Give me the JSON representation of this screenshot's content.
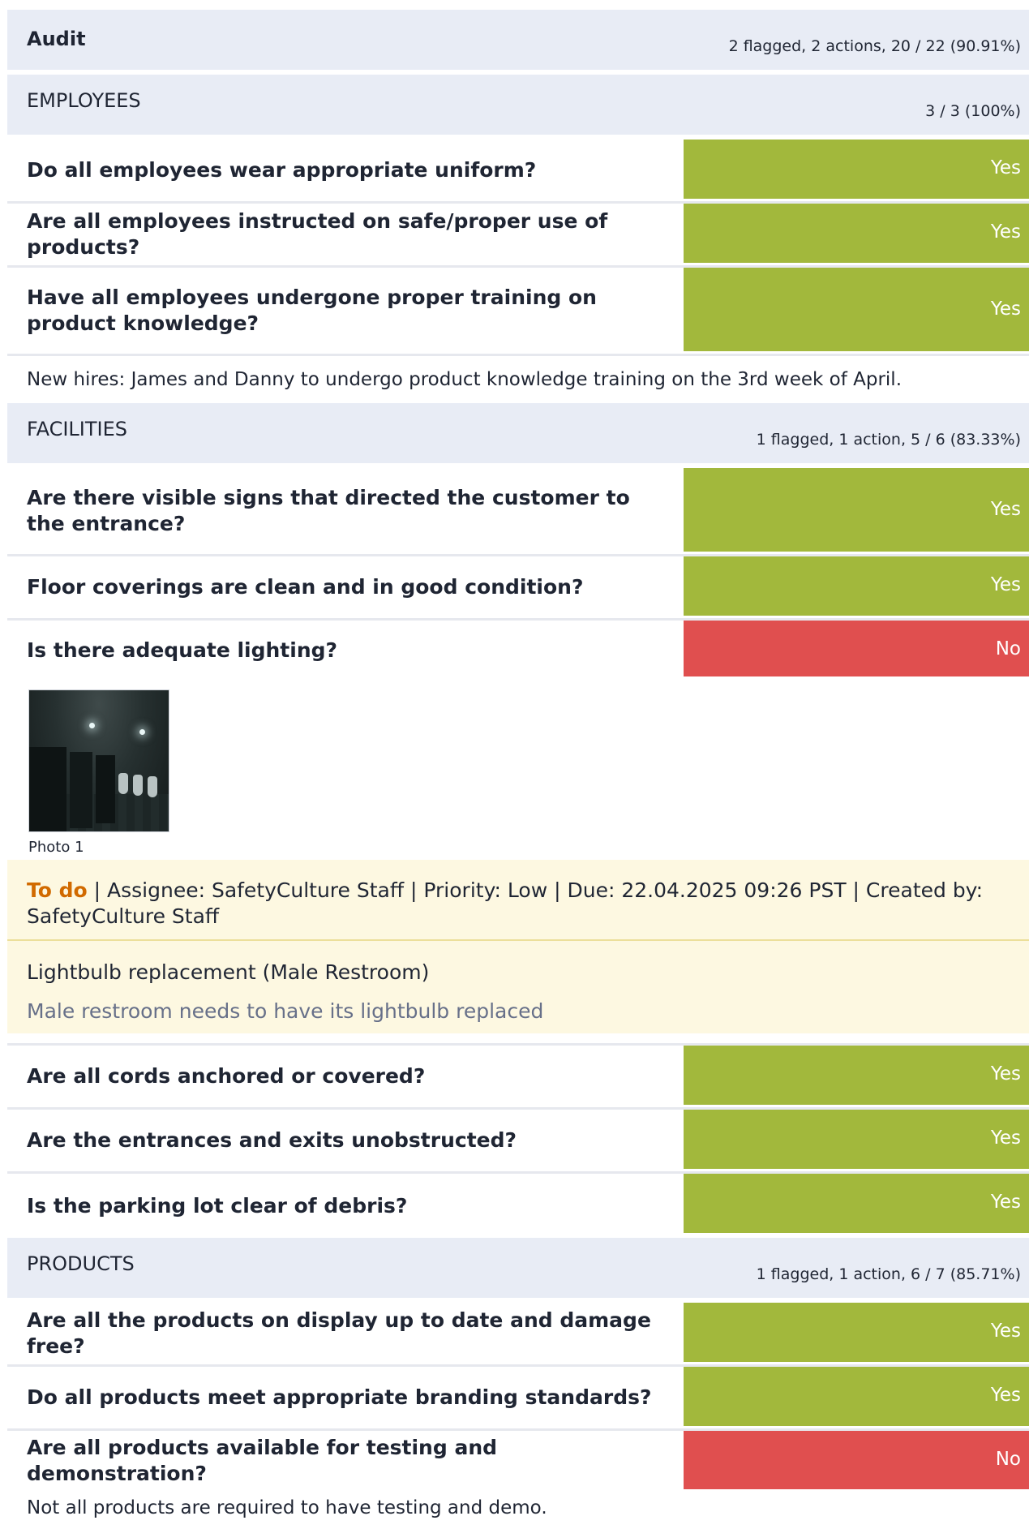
{
  "audit": {
    "title": "Audit",
    "stats": "2 flagged, 2 actions, 20 / 22 (90.91%)"
  },
  "sections": [
    {
      "title": "EMPLOYEES",
      "stats": "3 / 3 (100%)",
      "questions": [
        {
          "text": "Do all employees wear appropriate uniform?",
          "answer": "Yes"
        },
        {
          "text": "Are all employees instructed on safe/proper use of products?",
          "answer": "Yes"
        },
        {
          "text": "Have all employees undergone proper training on product knowledge?",
          "answer": "Yes"
        }
      ],
      "note": "New hires: James and Danny to undergo product knowledge training on the 3rd week of April."
    },
    {
      "title": "FACILITIES",
      "stats": "1 flagged, 1 action, 5 / 6 (83.33%)",
      "questions": [
        {
          "text": "Are there visible signs that directed the customer to the entrance?",
          "answer": "Yes"
        },
        {
          "text": "Floor coverings are clean and in good condition?",
          "answer": "Yes"
        },
        {
          "text": "Is there adequate lighting?",
          "answer": "No"
        },
        {
          "text": "Are all cords anchored or covered?",
          "answer": "Yes"
        },
        {
          "text": "Are the entrances and exits unobstructed?",
          "answer": "Yes"
        },
        {
          "text": "Is the parking lot clear of debris?",
          "answer": "Yes"
        }
      ],
      "photo_caption": "Photo 1",
      "action": {
        "status": "To do",
        "details": " |  Assignee: SafetyCulture Staff  |  Priority: Low  |  Due: 22.04.2025 09:26 PST  |  Created by: SafetyCulture Staff",
        "title": "Lightbulb replacement (Male Restroom)",
        "description": "Male restroom needs to have its lightbulb replaced"
      }
    },
    {
      "title": "PRODUCTS",
      "stats": "1 flagged, 1 action, 6 / 7 (85.71%)",
      "questions": [
        {
          "text": "Are all the products on display up to date and damage free?",
          "answer": "Yes"
        },
        {
          "text": "Do all products meet appropriate branding standards?",
          "answer": "Yes"
        },
        {
          "text": "Are all products available for testing and demonstration?",
          "answer": "No"
        }
      ],
      "note": "Not all products are required to have testing and demo."
    }
  ],
  "colors": {
    "yes": "#a2b83c",
    "no": "#e04f4f",
    "header_bg": "#e8ecf5",
    "action_bg": "#fdf8e1",
    "todo": "#d16a00"
  }
}
